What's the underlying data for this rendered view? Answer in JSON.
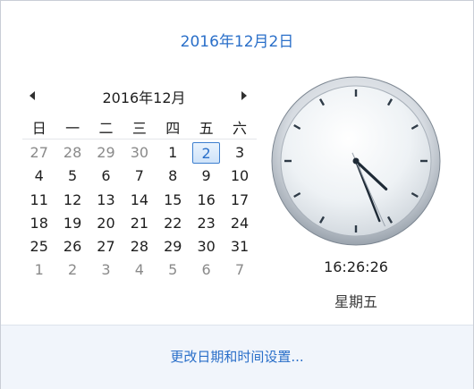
{
  "header": {
    "date": "2016年12月2日"
  },
  "calendar": {
    "month_title": "2016年12月",
    "weekdays": [
      "日",
      "一",
      "二",
      "三",
      "四",
      "五",
      "六"
    ],
    "weeks": [
      [
        {
          "d": "27",
          "other": true
        },
        {
          "d": "28",
          "other": true
        },
        {
          "d": "29",
          "other": true
        },
        {
          "d": "30",
          "other": true
        },
        {
          "d": "1"
        },
        {
          "d": "2",
          "today": true
        },
        {
          "d": "3"
        }
      ],
      [
        {
          "d": "4"
        },
        {
          "d": "5"
        },
        {
          "d": "6"
        },
        {
          "d": "7"
        },
        {
          "d": "8"
        },
        {
          "d": "9"
        },
        {
          "d": "10"
        }
      ],
      [
        {
          "d": "11"
        },
        {
          "d": "12"
        },
        {
          "d": "13"
        },
        {
          "d": "14"
        },
        {
          "d": "15"
        },
        {
          "d": "16"
        },
        {
          "d": "17"
        }
      ],
      [
        {
          "d": "18"
        },
        {
          "d": "19"
        },
        {
          "d": "20"
        },
        {
          "d": "21"
        },
        {
          "d": "22"
        },
        {
          "d": "23"
        },
        {
          "d": "24"
        }
      ],
      [
        {
          "d": "25"
        },
        {
          "d": "26"
        },
        {
          "d": "27"
        },
        {
          "d": "28"
        },
        {
          "d": "29"
        },
        {
          "d": "30"
        },
        {
          "d": "31"
        }
      ],
      [
        {
          "d": "1",
          "other": true
        },
        {
          "d": "2",
          "other": true
        },
        {
          "d": "3",
          "other": true
        },
        {
          "d": "4",
          "other": true
        },
        {
          "d": "5",
          "other": true
        },
        {
          "d": "6",
          "other": true
        },
        {
          "d": "7",
          "other": true
        }
      ]
    ]
  },
  "clock": {
    "time": "16:26:26",
    "weekday": "星期五",
    "hours": 16,
    "minutes": 26,
    "seconds": 26
  },
  "footer": {
    "link": "更改日期和时间设置..."
  },
  "colors": {
    "accent": "#2a6fc9",
    "footer_bg": "#f1f5fb"
  }
}
